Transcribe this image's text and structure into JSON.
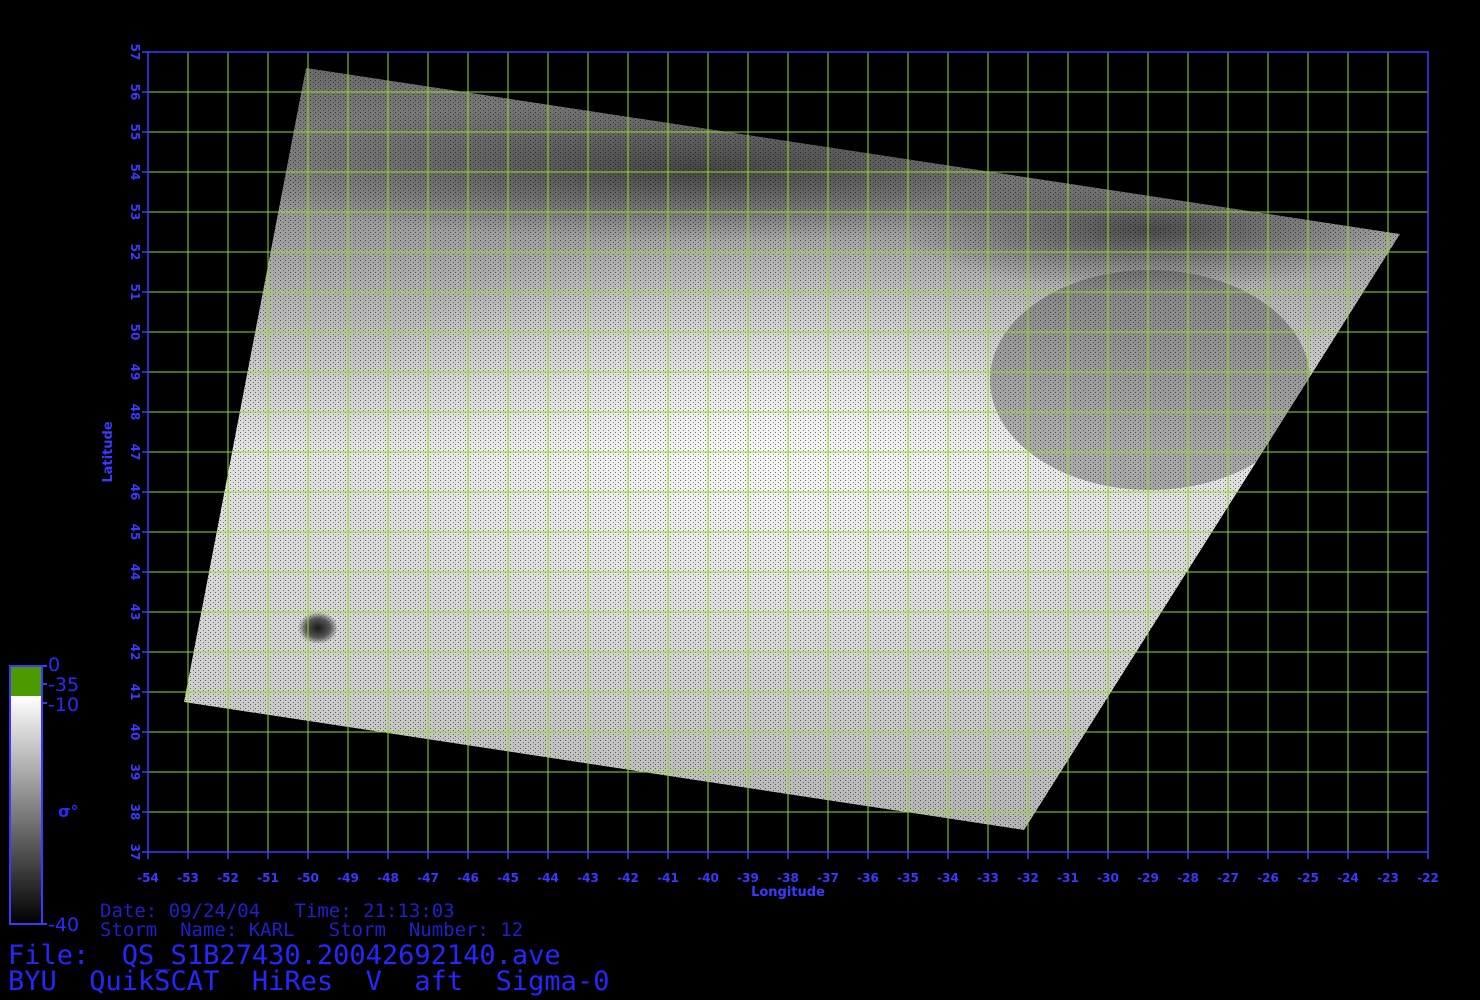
{
  "map": {
    "x_axis": {
      "label": "Longitude",
      "min": -54,
      "max": -22,
      "step": 1
    },
    "y_axis": {
      "label": "Latitude",
      "min": 37,
      "max": 57,
      "step": 1
    },
    "swath_corners_lonlat": [
      [
        -50.05,
        56.6
      ],
      [
        -22.7,
        52.45
      ],
      [
        -32.1,
        37.55
      ],
      [
        -53.1,
        40.75
      ]
    ],
    "eye_position_lonlat": [
      -49.75,
      42.6
    ],
    "colors": {
      "axis": "#3a3aff",
      "grid": "#8ee02a",
      "background": "#000000"
    }
  },
  "colorbar": {
    "label": "σ°",
    "top_value": "0",
    "mid_value_1": "-35",
    "mid_value_2": "-10",
    "bottom_value": "-40",
    "top_color": "#4c9a00",
    "ramp_top": "#ffffff",
    "ramp_bottom": "#000000"
  },
  "info": {
    "date_line": "Date: 09/24/04   Time: 21:13:03",
    "storm_line": "Storm  Name: KARL   Storm  Number: 12",
    "file_line": "File:  QS_S1B27430.20042692140.ave",
    "product_line": "BYU  QuikSCAT  HiRes  V  aft  Sigma-0"
  }
}
